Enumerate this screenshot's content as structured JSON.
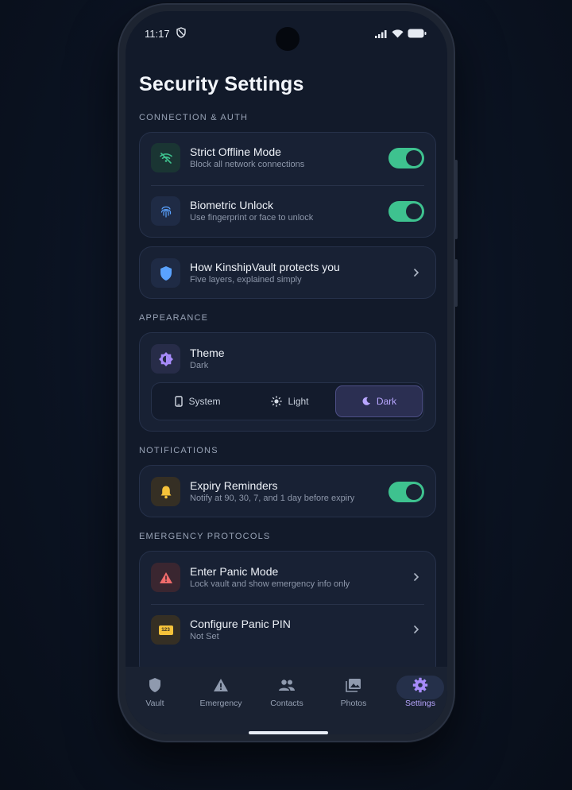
{
  "status": {
    "time": "11:17"
  },
  "page": {
    "title": "Security Settings"
  },
  "sections": {
    "connection": "CONNECTION & AUTH",
    "appearance": "APPEARANCE",
    "notifications": "NOTIFICATIONS",
    "emergency": "EMERGENCY PROTOCOLS"
  },
  "offline": {
    "title": "Strict Offline Mode",
    "subtitle": "Block all network connections",
    "enabled": true
  },
  "biometric": {
    "title": "Biometric Unlock",
    "subtitle": "Use fingerprint or face to unlock",
    "enabled": true
  },
  "protects": {
    "title": "How KinshipVault protects you",
    "subtitle": "Five layers, explained simply"
  },
  "theme": {
    "title": "Theme",
    "subtitle": "Dark",
    "options": [
      "System",
      "Light",
      "Dark"
    ],
    "selected": "Dark"
  },
  "expiry": {
    "title": "Expiry Reminders",
    "subtitle": "Notify at 90, 30, 7, and 1 day before expiry",
    "enabled": true
  },
  "panic_mode": {
    "title": "Enter Panic Mode",
    "subtitle": "Lock vault and show emergency info only"
  },
  "panic_pin": {
    "title": "Configure Panic PIN",
    "subtitle": "Not Set",
    "icon_text": "123"
  },
  "nav": {
    "items": [
      "Vault",
      "Emergency",
      "Contacts",
      "Photos",
      "Settings"
    ],
    "active": "Settings"
  },
  "colors": {
    "accent_green": "#3ec28f",
    "accent_purple": "#a78bfa",
    "danger": "#f06b6b",
    "warning": "#f5c23a",
    "info_blue": "#5aa2ff"
  }
}
